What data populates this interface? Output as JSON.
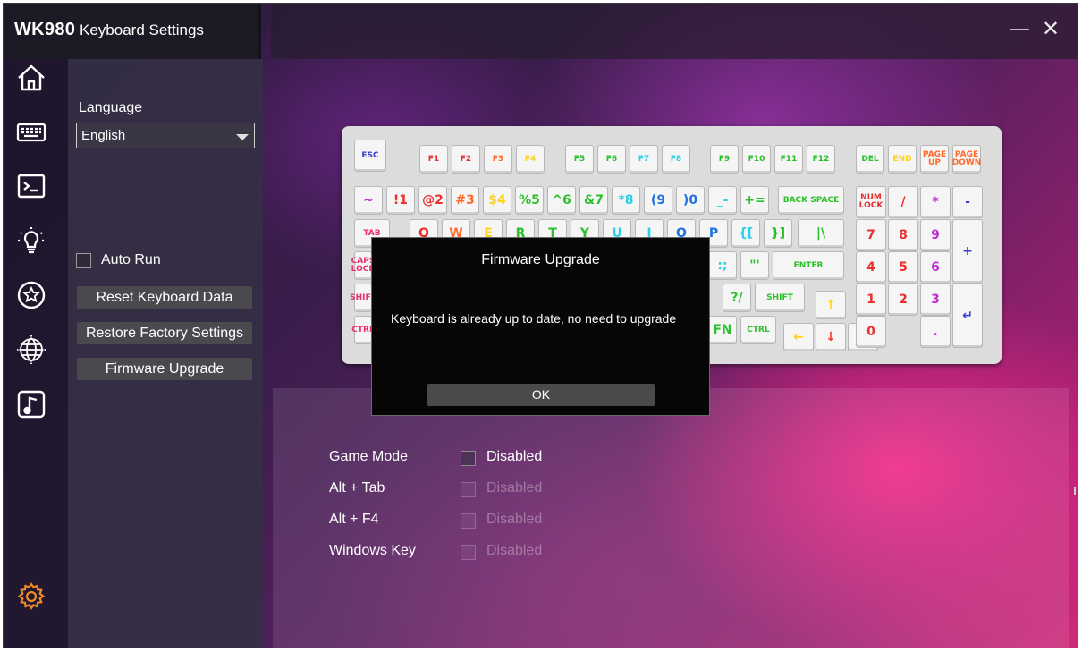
{
  "titlebar": {
    "app_name": "WK980",
    "subtitle": "Keyboard Settings",
    "minimize": "—",
    "close": "✕"
  },
  "nav": {
    "icons": [
      "home-icon",
      "keyboard-icon",
      "terminal-icon",
      "lightbulb-icon",
      "star-badge-icon",
      "globe-icon",
      "music-icon",
      "settings-gear-icon"
    ]
  },
  "settings": {
    "language_label": "Language",
    "language_value": "English",
    "auto_run_label": "Auto Run",
    "reset_button": "Reset Keyboard Data",
    "restore_button": "Restore Factory Settings",
    "firmware_button": "Firmware Upgrade"
  },
  "options": [
    {
      "label": "Game Mode",
      "value": "Disabled"
    },
    {
      "label": "Alt + Tab",
      "value": "Disabled"
    },
    {
      "label": "Alt + F4",
      "value": "Disabled"
    },
    {
      "label": "Windows Key",
      "value": "Disabled"
    }
  ],
  "dialog": {
    "title": "Firmware Upgrade",
    "message": "Keyboard is already up to date, no need to upgrade",
    "ok": "OK"
  },
  "keyboard": {
    "keys": [
      {
        "t": "ESC",
        "c": "#3b3bd6"
      },
      {
        "t": "F1",
        "c": "#e8302f"
      },
      {
        "t": "F2",
        "c": "#e8302f"
      },
      {
        "t": "F3",
        "c": "#ff6a2a"
      },
      {
        "t": "F4",
        "c": "#ffd21a"
      },
      {
        "t": "F5",
        "c": "#2cc02c"
      },
      {
        "t": "F6",
        "c": "#2cc02c"
      },
      {
        "t": "F7",
        "c": "#2ad0e8"
      },
      {
        "t": "F8",
        "c": "#2ad0e8"
      },
      {
        "t": "F9",
        "c": "#2cc02c"
      },
      {
        "t": "F10",
        "c": "#2cc02c"
      },
      {
        "t": "F11",
        "c": "#2cc02c"
      },
      {
        "t": "F12",
        "c": "#2cc02c"
      },
      {
        "t": "DEL",
        "c": "#2cc02c"
      },
      {
        "t": "END",
        "c": "#ffd21a"
      },
      {
        "t": "PAGE UP",
        "c": "#ff6a2a"
      },
      {
        "t": "PAGE DOWN",
        "c": "#ff6a2a"
      },
      {
        "t": "~",
        "c": "#c030d0"
      },
      {
        "t": "!1",
        "c": "#e8302f"
      },
      {
        "t": "@2",
        "c": "#e8302f"
      },
      {
        "t": "#3",
        "c": "#ff6a2a"
      },
      {
        "t": "$4",
        "c": "#ffd21a"
      },
      {
        "t": "%5",
        "c": "#2cc02c"
      },
      {
        "t": "^6",
        "c": "#2cc02c"
      },
      {
        "t": "&7",
        "c": "#2cc02c"
      },
      {
        "t": "*8",
        "c": "#2ad0e8"
      },
      {
        "t": "(9",
        "c": "#2070e0"
      },
      {
        "t": ")0",
        "c": "#2070e0"
      },
      {
        "t": "_-",
        "c": "#2ad0e8"
      },
      {
        "t": "+=",
        "c": "#2cc02c"
      },
      {
        "t": "BACK SPACE",
        "c": "#2cc02c"
      },
      {
        "t": "NUM LOCK",
        "c": "#e8302f"
      },
      {
        "t": "/",
        "c": "#e8302f"
      },
      {
        "t": "*",
        "c": "#c030d0"
      },
      {
        "t": "-",
        "c": "#3b3bd6"
      },
      {
        "t": "TAB",
        "c": "#e8306a"
      },
      {
        "t": "Q",
        "c": "#e8302f"
      },
      {
        "t": "W",
        "c": "#ff6a2a"
      },
      {
        "t": "E",
        "c": "#ffd21a"
      },
      {
        "t": "R",
        "c": "#2cc02c"
      },
      {
        "t": "T",
        "c": "#2cc02c"
      },
      {
        "t": "Y",
        "c": "#2cc02c"
      },
      {
        "t": "U",
        "c": "#2ad0e8"
      },
      {
        "t": "I",
        "c": "#2ad0e8"
      },
      {
        "t": "O",
        "c": "#2070e0"
      },
      {
        "t": "P",
        "c": "#2070e0"
      },
      {
        "t": "{[",
        "c": "#2ad0e8"
      },
      {
        "t": "}]",
        "c": "#2cc02c"
      },
      {
        "t": "|\\",
        "c": "#2cc02c"
      },
      {
        "t": "7",
        "c": "#e8302f"
      },
      {
        "t": "8",
        "c": "#e8302f"
      },
      {
        "t": "9",
        "c": "#c030d0"
      },
      {
        "t": "+",
        "c": "#3b3bd6"
      },
      {
        "t": "CAPS LOCK",
        "c": "#e8306a"
      },
      {
        "t": ":;",
        "c": "#2ad0e8"
      },
      {
        "t": "\"'",
        "c": "#2cc02c"
      },
      {
        "t": "ENTER",
        "c": "#2cc02c"
      },
      {
        "t": "4",
        "c": "#e8302f"
      },
      {
        "t": "5",
        "c": "#e8302f"
      },
      {
        "t": "6",
        "c": "#c030d0"
      },
      {
        "t": "SHIFT",
        "c": "#e8306a"
      },
      {
        "t": "?/",
        "c": "#2cc02c"
      },
      {
        "t": "SHIFT",
        "c": "#2cc02c"
      },
      {
        "t": "↑",
        "c": "#ffd21a"
      },
      {
        "t": "1",
        "c": "#e8302f"
      },
      {
        "t": "2",
        "c": "#e8302f"
      },
      {
        "t": "3",
        "c": "#c030d0"
      },
      {
        "t": "↵",
        "c": "#3b3bd6"
      },
      {
        "t": "CTRL",
        "c": "#e8306a"
      },
      {
        "t": "FN",
        "c": "#2cc02c"
      },
      {
        "t": "CTRL",
        "c": "#2cc02c"
      },
      {
        "t": "←",
        "c": "#ffd21a"
      },
      {
        "t": "↓",
        "c": "#ff3a2a"
      },
      {
        "t": "→",
        "c": "#ff3a2a"
      },
      {
        "t": "0",
        "c": "#e8302f"
      },
      {
        "t": ".",
        "c": "#c030d0"
      }
    ]
  }
}
